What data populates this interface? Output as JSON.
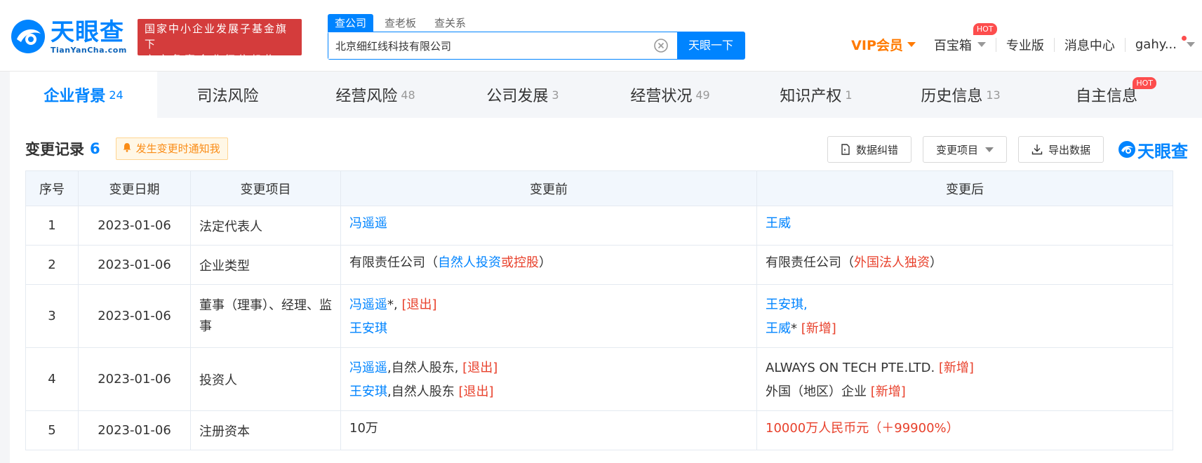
{
  "header": {
    "logo_cn": "天眼查",
    "logo_en": "TianYanCha.com",
    "badge_line1": "国家中小企业发展子基金旗下",
    "badge_line2": "官方备案企业征信机构",
    "search_tabs": [
      "查公司",
      "查老板",
      "查关系"
    ],
    "search_value": "北京细红线科技有限公司",
    "search_button": "天眼一下",
    "vip_label": "VIP会员",
    "treasure_label": "百宝箱",
    "hot_label": "HOT",
    "pro_label": "专业版",
    "messages_label": "消息中心",
    "user_label": "gahy..."
  },
  "tabs": [
    {
      "label": "企业背景",
      "count": "24"
    },
    {
      "label": "司法风险",
      "count": ""
    },
    {
      "label": "经营风险",
      "count": "48"
    },
    {
      "label": "公司发展",
      "count": "3"
    },
    {
      "label": "经营状况",
      "count": "49"
    },
    {
      "label": "知识产权",
      "count": "1"
    },
    {
      "label": "历史信息",
      "count": "13"
    },
    {
      "label": "自主信息",
      "count": ""
    }
  ],
  "tabs_hot": "HOT",
  "section": {
    "title": "变更记录",
    "count": "6",
    "notify_label": "发生变更时通知我",
    "btn_correct": "数据纠错",
    "btn_items": "变更项目",
    "btn_export": "导出数据",
    "mini_logo": "天眼查"
  },
  "table": {
    "headers": [
      "序号",
      "变更日期",
      "变更项目",
      "变更前",
      "变更后"
    ],
    "rows": [
      {
        "no": "1",
        "date": "2023-01-06",
        "item": "法定代表人",
        "before": [
          [
            {
              "t": "冯遥遥",
              "c": "blue"
            }
          ]
        ],
        "after": [
          [
            {
              "t": "王威",
              "c": "blue"
            }
          ]
        ]
      },
      {
        "no": "2",
        "date": "2023-01-06",
        "item": "企业类型",
        "before": [
          [
            {
              "t": "有限责任公司（",
              "c": ""
            },
            {
              "t": "自然人投资",
              "c": "blue"
            },
            {
              "t": "或控股",
              "c": "red"
            },
            {
              "t": "）",
              "c": ""
            }
          ]
        ],
        "after": [
          [
            {
              "t": "有限责任公司（",
              "c": ""
            },
            {
              "t": "外国法人独资",
              "c": "red"
            },
            {
              "t": "）",
              "c": ""
            }
          ]
        ]
      },
      {
        "no": "3",
        "date": "2023-01-06",
        "item": "董事（理事）、经理、监事",
        "before": [
          [
            {
              "t": "冯遥遥",
              "c": "blue"
            },
            {
              "t": "*, ",
              "c": ""
            },
            {
              "t": "[退出]",
              "c": "red"
            }
          ],
          [
            {
              "t": "王安琪",
              "c": "blue"
            }
          ]
        ],
        "after": [
          [
            {
              "t": "王安琪,",
              "c": "blue"
            }
          ],
          [
            {
              "t": "王威",
              "c": "blue"
            },
            {
              "t": "* ",
              "c": ""
            },
            {
              "t": "[新增]",
              "c": "red"
            }
          ]
        ]
      },
      {
        "no": "4",
        "date": "2023-01-06",
        "item": "投资人",
        "before": [
          [
            {
              "t": "冯遥遥",
              "c": "blue"
            },
            {
              "t": ",自然人股东, ",
              "c": ""
            },
            {
              "t": "[退出]",
              "c": "red"
            }
          ],
          [
            {
              "t": "王安琪",
              "c": "blue"
            },
            {
              "t": ",自然人股东 ",
              "c": ""
            },
            {
              "t": "[退出]",
              "c": "red"
            }
          ]
        ],
        "after": [
          [
            {
              "t": "ALWAYS ON TECH PTE.LTD. ",
              "c": ""
            },
            {
              "t": "[新增]",
              "c": "red"
            }
          ],
          [
            {
              "t": "外国（地区）企业 ",
              "c": ""
            },
            {
              "t": "[新增]",
              "c": "red"
            }
          ]
        ]
      },
      {
        "no": "5",
        "date": "2023-01-06",
        "item": "注册资本",
        "before": [
          [
            {
              "t": "10万",
              "c": ""
            }
          ]
        ],
        "after": [
          [
            {
              "t": "10000万人民币元（＋99900%）",
              "c": "red"
            }
          ]
        ]
      }
    ]
  },
  "colors": {
    "brand": "#0084ff",
    "red": "#e8412c",
    "vip": "#ff7a00"
  }
}
